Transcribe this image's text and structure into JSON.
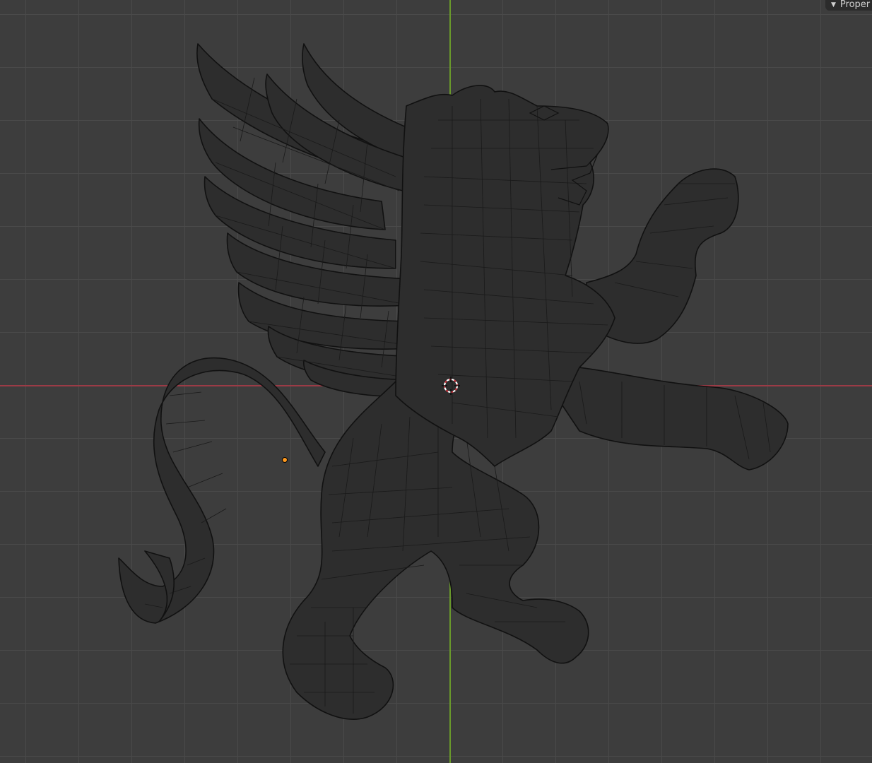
{
  "panel": {
    "properties_label": "Proper",
    "toggle_symbol": "▼"
  },
  "viewport": {
    "icons": {
      "cursor": "3d-cursor-icon",
      "origin": "object-origin-icon"
    }
  },
  "colors": {
    "background": "#3d3d3d",
    "grid_line": "#4a4a4a",
    "x_axis": "#9b3b46",
    "y_axis": "#6a9a2b",
    "mesh": "#2d2d2d",
    "origin": "#ff9a1f"
  }
}
